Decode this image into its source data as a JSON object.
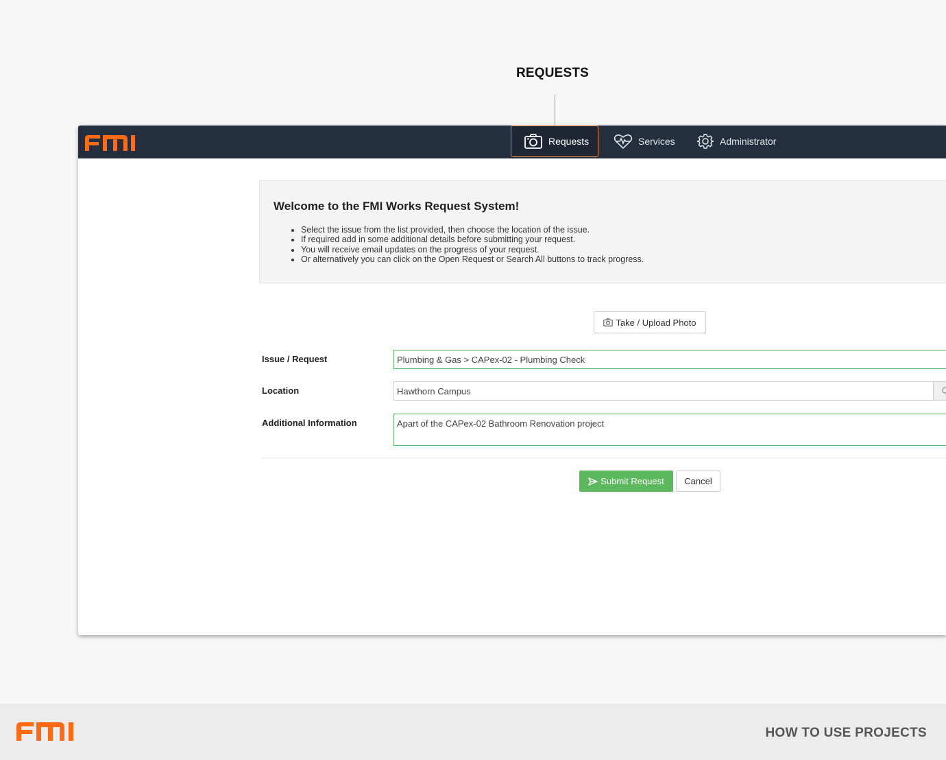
{
  "callout": {
    "label": "REQUESTS"
  },
  "brand": {
    "logo_text": "FMI",
    "accent": "#ff6a13",
    "nav_bg": "#232f3e",
    "success": "#5cb85c"
  },
  "nav": {
    "items": [
      {
        "label": "Requests",
        "icon": "camera-icon",
        "active": true
      },
      {
        "label": "Services",
        "icon": "heartbeat-icon"
      },
      {
        "label": "Administrator",
        "icon": "gear-icon"
      }
    ]
  },
  "welcome": {
    "title": "Welcome to the FMI Works Request System!",
    "bullets": [
      "Select the issue from the list provided, then choose the location of the issue.",
      "If required add in some additional details before submitting your request.",
      "You will receive email updates on the progress of your request.",
      "Or alternatively you can click on the Open Request or Search All buttons to track progress."
    ]
  },
  "photo_button": {
    "label": "Take / Upload Photo",
    "icon": "camera-icon"
  },
  "form": {
    "issue": {
      "label": "Issue / Request",
      "value": "Plumbing & Gas > CAPex-02 - Plumbing Check"
    },
    "location": {
      "label": "Location",
      "value": "Hawthorn Campus"
    },
    "info": {
      "label": "Additional Information",
      "value": "Apart of the CAPex-02 Bathroom Renovation project"
    }
  },
  "actions": {
    "submit_label": "Submit Request",
    "cancel_label": "Cancel"
  },
  "footer": {
    "title": "HOW TO USE PROJECTS",
    "logo_text": "FMI"
  }
}
